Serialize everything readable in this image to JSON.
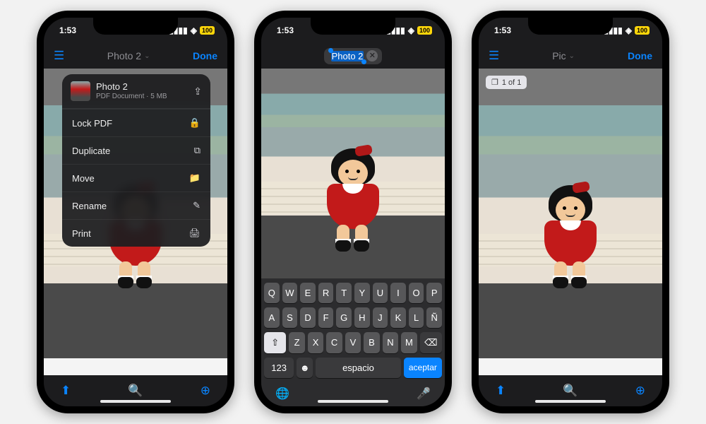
{
  "status": {
    "time": "1:53",
    "battery": "100"
  },
  "phone1": {
    "title": "Photo 2",
    "done": "Done",
    "menu": {
      "name": "Photo 2",
      "subtitle": "PDF Document · 5 MB",
      "items": [
        {
          "label": "Lock PDF",
          "icon": "lock-icon",
          "glyph": "🔒"
        },
        {
          "label": "Duplicate",
          "icon": "duplicate-icon",
          "glyph": "⧉"
        },
        {
          "label": "Move",
          "icon": "folder-icon",
          "glyph": "📁"
        },
        {
          "label": "Rename",
          "icon": "pencil-icon",
          "glyph": "✎"
        },
        {
          "label": "Print",
          "icon": "printer-icon",
          "glyph": "🖨"
        }
      ]
    }
  },
  "phone2": {
    "editing_title": "Photo 2",
    "keyboard": {
      "row1": [
        "Q",
        "W",
        "E",
        "R",
        "T",
        "Y",
        "U",
        "I",
        "O",
        "P"
      ],
      "row2": [
        "A",
        "S",
        "D",
        "F",
        "G",
        "H",
        "J",
        "K",
        "L",
        "Ñ"
      ],
      "row3": [
        "Z",
        "X",
        "C",
        "V",
        "B",
        "N",
        "M"
      ],
      "numbers": "123",
      "space": "espacio",
      "accept": "aceptar"
    }
  },
  "phone3": {
    "title": "Pic",
    "done": "Done",
    "page_indicator": "1 of 1"
  }
}
